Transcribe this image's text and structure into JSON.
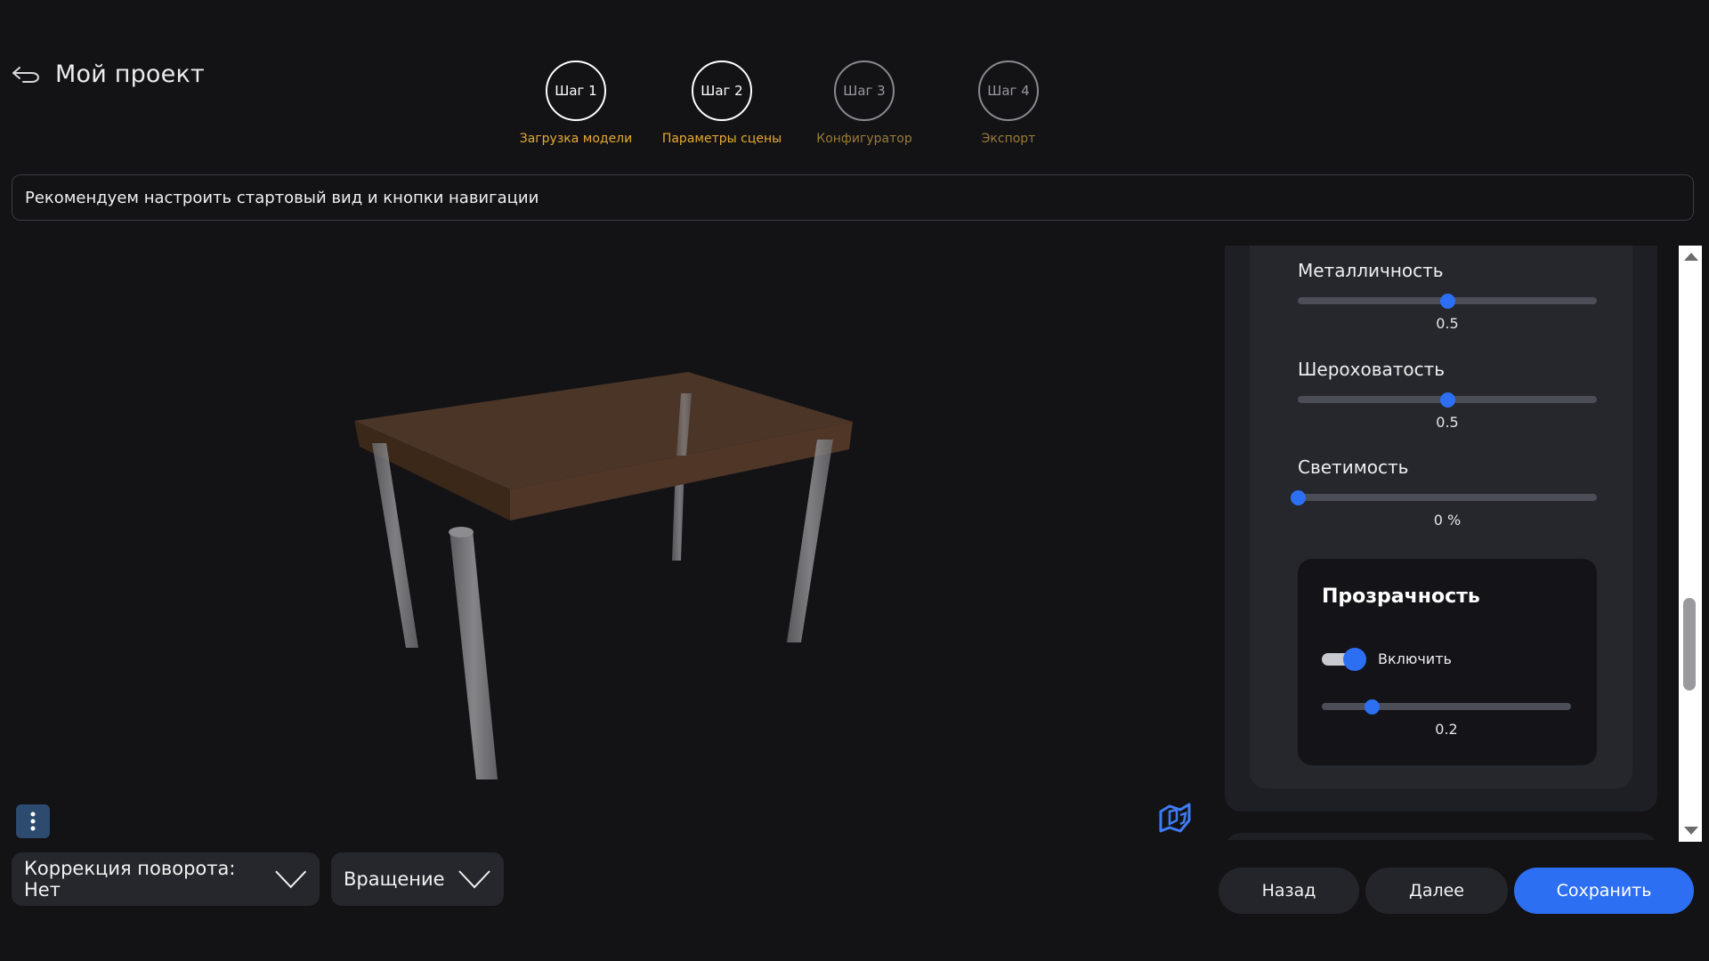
{
  "header": {
    "title": "Мой проект"
  },
  "steps": [
    {
      "circle": "Шаг 1",
      "label": "Загрузка модели",
      "state": "done"
    },
    {
      "circle": "Шаг 2",
      "label": "Параметры сцены",
      "state": "active"
    },
    {
      "circle": "Шаг 3",
      "label": "Конфигуратор",
      "state": "inactive"
    },
    {
      "circle": "Шаг 4",
      "label": "Экспорт",
      "state": "inactive"
    }
  ],
  "hint": "Рекомендуем настроить стартовый вид и кнопки навигации",
  "viewer": {
    "icons": [
      "back-arrow-icon",
      "more-vertical-icon",
      "logo-3d-icon",
      "chevron-down-icon"
    ]
  },
  "controls": {
    "rotation_correction": "Коррекция поворота: Нет",
    "rotation_mode": "Вращение"
  },
  "material": {
    "metalness": {
      "label": "Металличность",
      "value": "0.5",
      "level": 0.5
    },
    "roughness": {
      "label": "Шероховатость",
      "value": "0.5",
      "level": 0.5
    },
    "emissive": {
      "label": "Светимость",
      "value": "0 %",
      "level": 0.0
    },
    "transparency": {
      "title": "Прозрачность",
      "toggle_label": "Включить",
      "enabled": true,
      "value": "0.2",
      "level": 0.2
    }
  },
  "footer": {
    "back": "Назад",
    "next": "Далее",
    "save": "Сохранить"
  },
  "colors": {
    "accent": "#2d6ff2",
    "step_label": "#e8a930",
    "background": "#131316"
  }
}
